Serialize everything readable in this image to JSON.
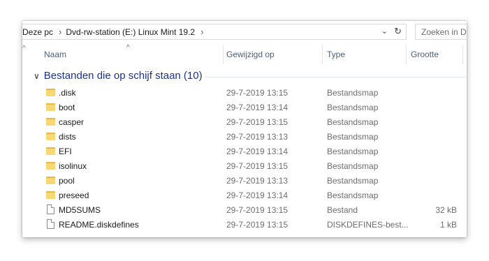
{
  "address": {
    "crumbs": [
      "Deze pc",
      "Dvd-rw-station (E:) Linux Mint 19.2"
    ]
  },
  "search": {
    "placeholder": "Zoeken in Dv"
  },
  "columns": {
    "name": "Naam",
    "modified": "Gewijzigd op",
    "type": "Type",
    "size": "Grootte"
  },
  "group": {
    "title": "Bestanden die op schijf staan (10)"
  },
  "files": [
    {
      "name": ".disk",
      "modified": "29-7-2019 13:15",
      "type": "Bestandsmap",
      "size": "",
      "icon": "folder-icon"
    },
    {
      "name": "boot",
      "modified": "29-7-2019 13:14",
      "type": "Bestandsmap",
      "size": "",
      "icon": "folder-icon"
    },
    {
      "name": "casper",
      "modified": "29-7-2019 13:15",
      "type": "Bestandsmap",
      "size": "",
      "icon": "folder-icon"
    },
    {
      "name": "dists",
      "modified": "29-7-2019 13:13",
      "type": "Bestandsmap",
      "size": "",
      "icon": "folder-icon"
    },
    {
      "name": "EFI",
      "modified": "29-7-2019 13:14",
      "type": "Bestandsmap",
      "size": "",
      "icon": "folder-icon"
    },
    {
      "name": "isolinux",
      "modified": "29-7-2019 13:15",
      "type": "Bestandsmap",
      "size": "",
      "icon": "folder-icon"
    },
    {
      "name": "pool",
      "modified": "29-7-2019 13:13",
      "type": "Bestandsmap",
      "size": "",
      "icon": "folder-icon"
    },
    {
      "name": "preseed",
      "modified": "29-7-2019 13:14",
      "type": "Bestandsmap",
      "size": "",
      "icon": "folder-icon"
    },
    {
      "name": "MD5SUMS",
      "modified": "29-7-2019 13:15",
      "type": "Bestand",
      "size": "32 kB",
      "icon": "file-icon"
    },
    {
      "name": "README.diskdefines",
      "modified": "29-7-2019 13:15",
      "type": "DISKDEFINES-best...",
      "size": "1 kB",
      "icon": "file-icon"
    }
  ],
  "colors": {
    "group_header": "#1e3287",
    "folder": "#f8d775",
    "column_title": "#4c607a"
  }
}
